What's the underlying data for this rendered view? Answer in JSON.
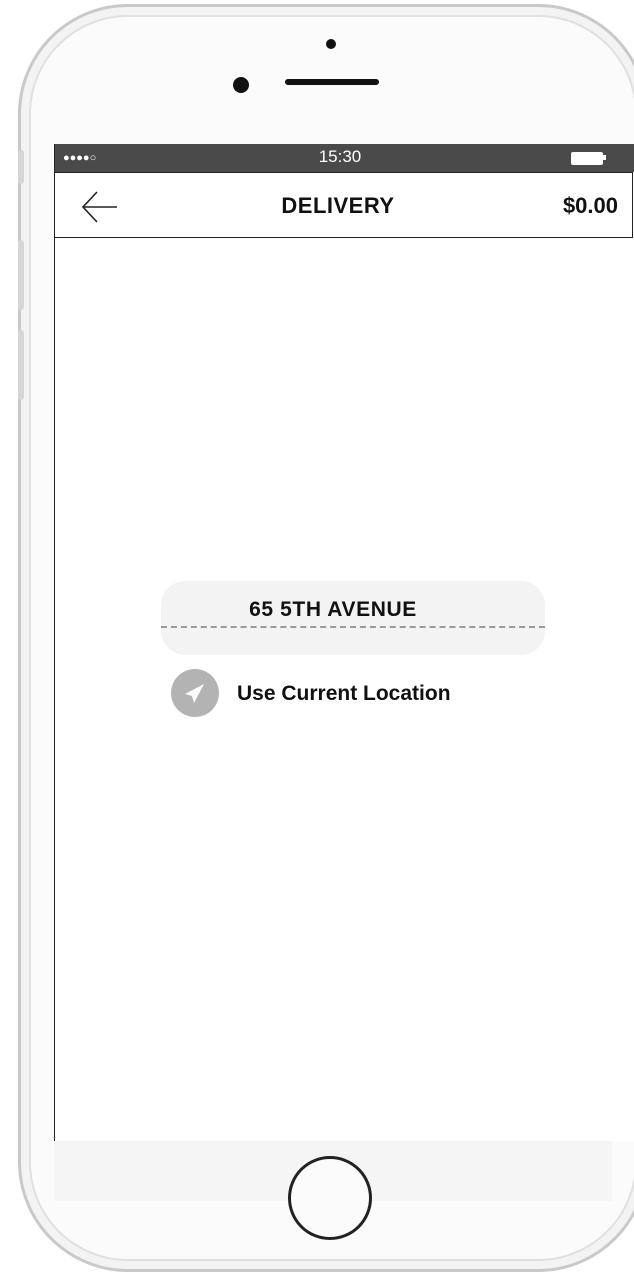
{
  "status_bar": {
    "signal": "●●●●○",
    "time": "15:30",
    "battery_icon": "battery-icon"
  },
  "nav": {
    "back_icon": "arrow-left-icon",
    "title": "DELIVERY",
    "price": "$0.00"
  },
  "address": {
    "value": "65 5TH AVENUE"
  },
  "location": {
    "icon": "navigation-arrow-icon",
    "label": "Use Current Location"
  },
  "device": {
    "home_button": "home-button"
  }
}
